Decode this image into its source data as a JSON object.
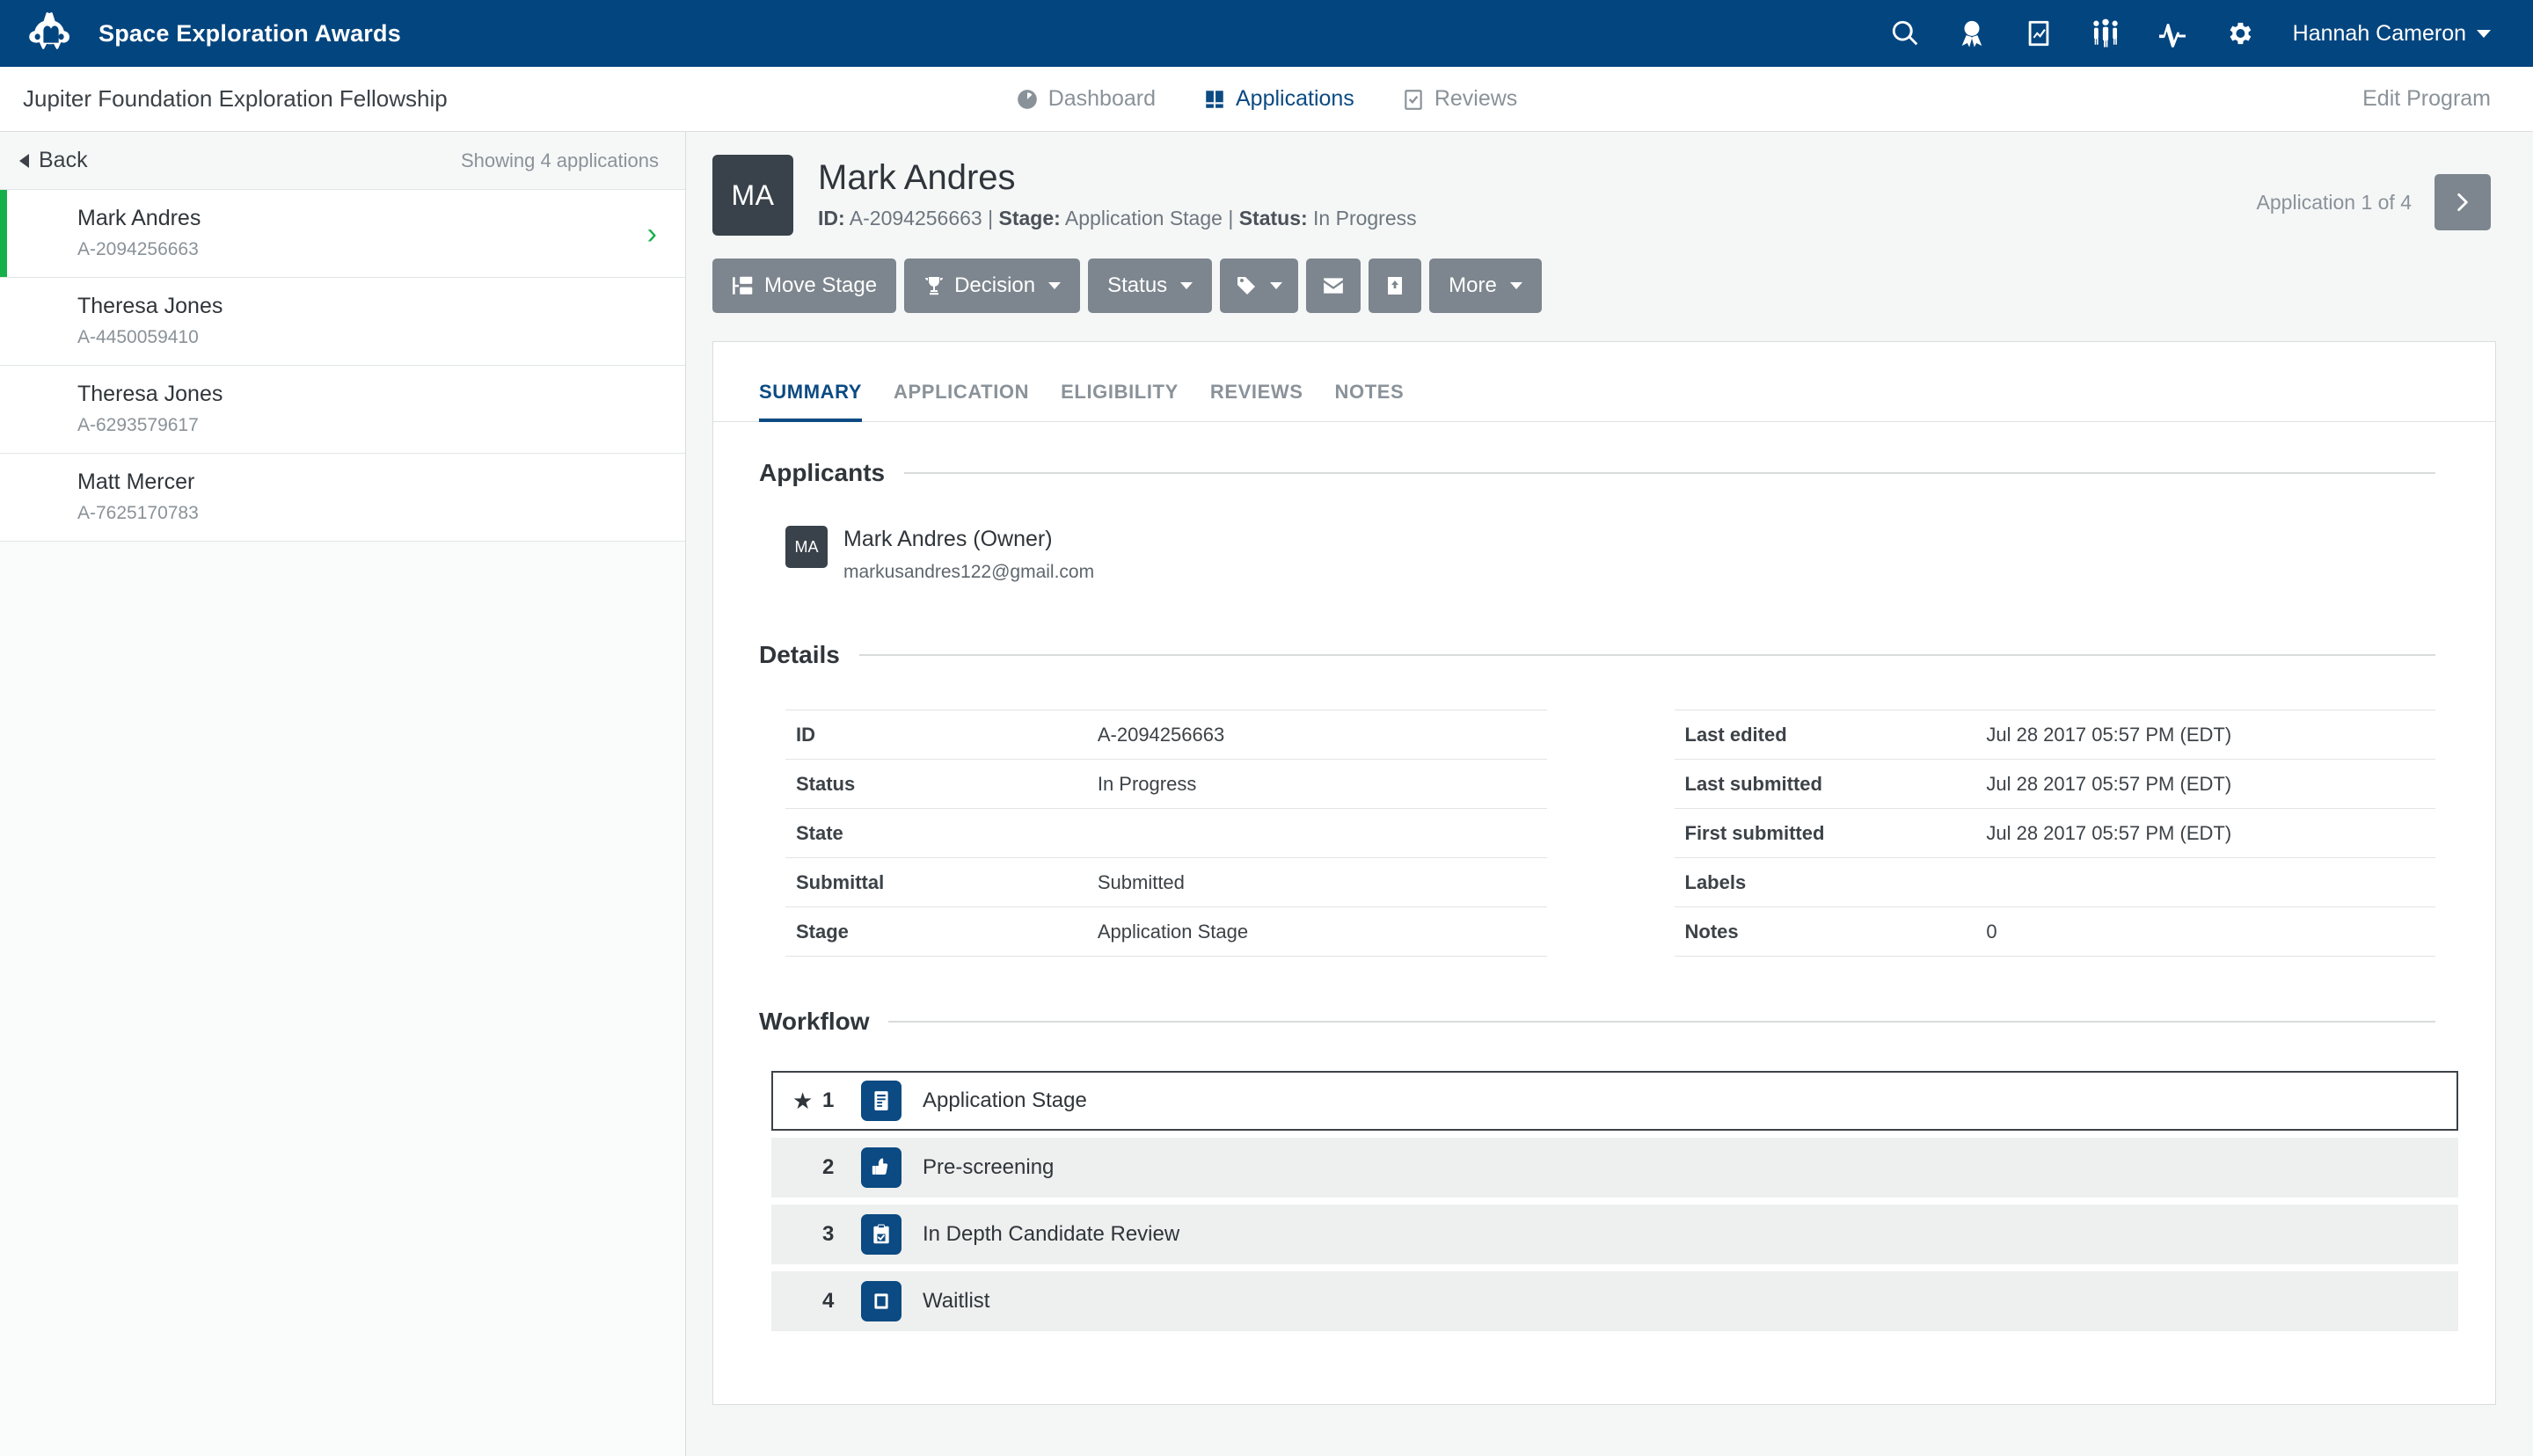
{
  "topnav": {
    "brand": "Space Exploration Awards",
    "icons": [
      {
        "name": "search-icon",
        "label": "Search"
      },
      {
        "name": "award-icon",
        "label": "Awards"
      },
      {
        "name": "report-icon",
        "label": "Reports"
      },
      {
        "name": "people-icon",
        "label": "People"
      },
      {
        "name": "activity-icon",
        "label": "Activity"
      },
      {
        "name": "gear-icon",
        "label": "Settings"
      }
    ],
    "user": "Hannah Cameron",
    "brand_color": "#03457f"
  },
  "subnav": {
    "program_title": "Jupiter Foundation Exploration Fellowship",
    "items": [
      {
        "label": "Dashboard",
        "icon": "gauge-icon",
        "active": false
      },
      {
        "label": "Applications",
        "icon": "book-icon",
        "active": true
      },
      {
        "label": "Reviews",
        "icon": "clipboard-check-icon",
        "active": false
      }
    ],
    "edit_program": "Edit Program"
  },
  "sidebar": {
    "back_label": "Back",
    "showing": "Showing 4 applications",
    "applications": [
      {
        "name": "Mark Andres",
        "id": "A-2094256663",
        "selected": true
      },
      {
        "name": "Theresa Jones",
        "id": "A-4450059410",
        "selected": false
      },
      {
        "name": "Theresa Jones",
        "id": "A-6293579617",
        "selected": false
      },
      {
        "name": "Matt Mercer",
        "id": "A-7625170783",
        "selected": false
      }
    ],
    "selected_accent": "#16b04b"
  },
  "header": {
    "avatar_initials": "MA",
    "name": "Mark Andres",
    "meta_id_label": "ID:",
    "meta_id_value": "A-2094256663",
    "meta_stage_label": "Stage:",
    "meta_stage_value": "Application Stage",
    "meta_status_label": "Status:",
    "meta_status_value": "In Progress",
    "counter": "Application 1 of 4",
    "next_label": "Next application"
  },
  "toolbar": {
    "buttons": [
      {
        "label": "Move Stage",
        "icon": "move-stage-icon",
        "caret": false
      },
      {
        "label": "Decision",
        "icon": "trophy-icon",
        "caret": true
      },
      {
        "label": "Status",
        "icon": "",
        "caret": true
      },
      {
        "label": "",
        "icon": "tag-icon",
        "caret": true
      },
      {
        "label": "",
        "icon": "envelope-icon",
        "caret": false
      },
      {
        "label": "",
        "icon": "download-icon",
        "caret": false
      },
      {
        "label": "More",
        "icon": "",
        "caret": true
      }
    ],
    "button_color": "#7d868e"
  },
  "tabs": [
    {
      "label": "SUMMARY",
      "active": true
    },
    {
      "label": "APPLICATION",
      "active": false
    },
    {
      "label": "ELIGIBILITY",
      "active": false
    },
    {
      "label": "REVIEWS",
      "active": false
    },
    {
      "label": "NOTES",
      "active": false
    }
  ],
  "applicants": {
    "section_title": "Applicants",
    "people": [
      {
        "initials": "MA",
        "name": "Mark Andres (Owner)",
        "email": "markusandres122@gmail.com"
      }
    ]
  },
  "details": {
    "section_title": "Details",
    "left": [
      {
        "key": "ID",
        "value": "A-2094256663"
      },
      {
        "key": "Status",
        "value": "In Progress"
      },
      {
        "key": "State",
        "value": ""
      },
      {
        "key": "Submittal",
        "value": "Submitted"
      },
      {
        "key": "Stage",
        "value": "Application Stage"
      }
    ],
    "right": [
      {
        "key": "Last edited",
        "value": "Jul 28 2017 05:57 PM (EDT)"
      },
      {
        "key": "Last submitted",
        "value": "Jul 28 2017 05:57 PM (EDT)"
      },
      {
        "key": "First submitted",
        "value": "Jul 28 2017 05:57 PM (EDT)"
      },
      {
        "key": "Labels",
        "value": ""
      },
      {
        "key": "Notes",
        "value": "0"
      }
    ]
  },
  "workflow": {
    "section_title": "Workflow",
    "stages": [
      {
        "num": "1",
        "label": "Application Stage",
        "icon": "document-icon",
        "current": true,
        "star": "★"
      },
      {
        "num": "2",
        "label": "Pre-screening",
        "icon": "thumbs-up-icon",
        "current": false,
        "star": ""
      },
      {
        "num": "3",
        "label": "In Depth Candidate Review",
        "icon": "clipboard-check-icon",
        "current": false,
        "star": ""
      },
      {
        "num": "4",
        "label": "Waitlist",
        "icon": "waitlist-icon",
        "current": false,
        "star": ""
      }
    ],
    "icon_color": "#0b4a82"
  }
}
